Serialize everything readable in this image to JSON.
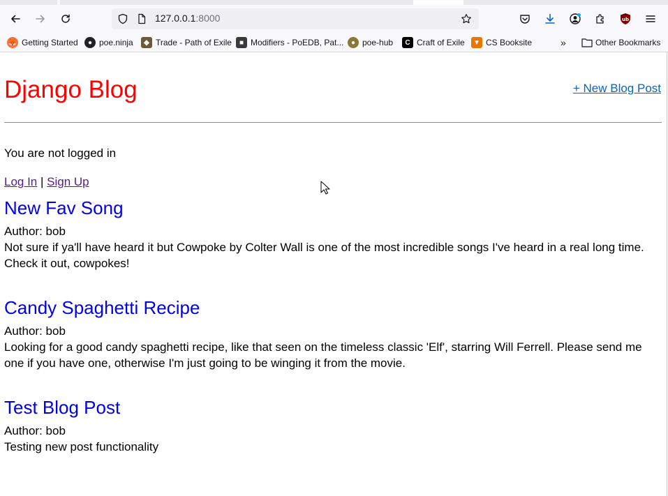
{
  "browser": {
    "url_host": "127.0.0.1",
    "url_port": ":8000",
    "bookmarks": [
      {
        "label": "Getting Started",
        "icon": "firefox-icon",
        "color": "#ff7139"
      },
      {
        "label": "poe.ninja",
        "icon": "ninja-icon",
        "color": "#222222"
      },
      {
        "label": "Trade - Path of Exile",
        "icon": "poe-trade-icon",
        "color": "#6b5a3a"
      },
      {
        "label": "Modifiers - PoEDB, Pat...",
        "icon": "poedb-icon",
        "color": "#3a3a3a"
      },
      {
        "label": "poe-hub",
        "icon": "poe-hub-icon",
        "color": "#8a7a3a"
      },
      {
        "label": "Craft of Exile",
        "icon": "craft-of-exile-icon",
        "color": "#000000"
      },
      {
        "label": "CS Booksite",
        "icon": "princeton-shield-icon",
        "color": "#e77500"
      }
    ],
    "other_bookmarks": "Other Bookmarks"
  },
  "header": {
    "site_title": "Django Blog",
    "new_post_link": "+ New Blog Post"
  },
  "auth": {
    "status": "You are not logged in",
    "login_label": "Log In",
    "separator": "|",
    "signup_label": "Sign Up"
  },
  "posts": [
    {
      "title": "New Fav Song",
      "author": "Author: bob",
      "body": "Not sure if ya'll have heard it but Cowpoke by Colter Wall is one of the most incredible songs I've heard in a real long time. Check it out, cowpokes!"
    },
    {
      "title": "Candy Spaghetti Recipe",
      "author": "Author: bob",
      "body": "Looking for a good candy spaghetti recipe, like that seen on the timeless classic 'Elf', starring Will Ferrell. Please send me one if you have one, otherwise I'm just going to be winging it from the movie."
    },
    {
      "title": "Test Blog Post",
      "author": "Author: bob",
      "body": "Testing new post functionality"
    }
  ],
  "colors": {
    "site_title": "#ff0000",
    "post_title": "#0000ee",
    "visited_link": "#551a8b",
    "link": "#0a65c2"
  }
}
